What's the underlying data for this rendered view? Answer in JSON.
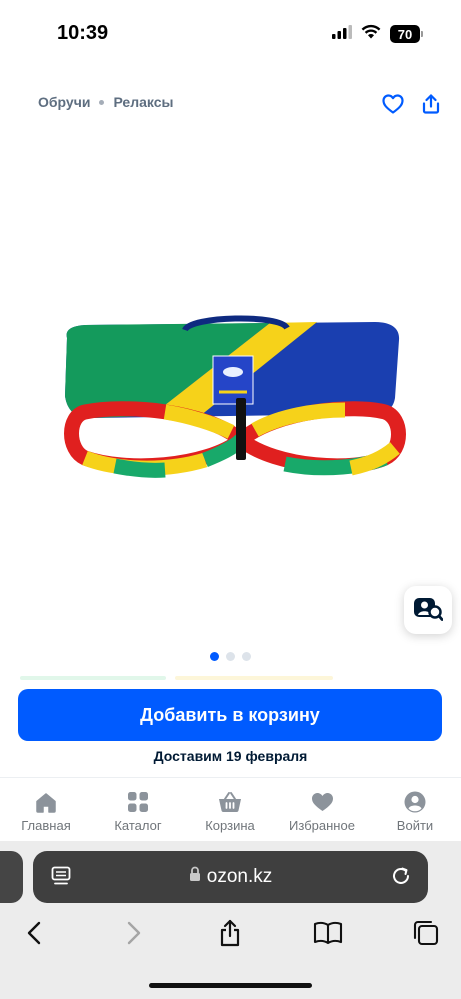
{
  "status": {
    "time": "10:39",
    "battery": "70"
  },
  "breadcrumb": {
    "items": [
      "Обручи",
      "Релаксы"
    ]
  },
  "carousel": {
    "count": 3,
    "active": 0
  },
  "cta": {
    "add_to_cart": "Добавить в корзину",
    "delivery": "Доставим 19 февраля"
  },
  "tabbar": {
    "items": [
      {
        "label": "Главная",
        "icon": "home-icon"
      },
      {
        "label": "Каталог",
        "icon": "catalog-icon"
      },
      {
        "label": "Корзина",
        "icon": "cart-icon"
      },
      {
        "label": "Избранное",
        "icon": "heart-icon"
      },
      {
        "label": "Войти",
        "icon": "profile-icon"
      }
    ]
  },
  "browser": {
    "url": "ozon.kz"
  },
  "colors": {
    "accent": "#005bff",
    "text": "#001a34",
    "muted": "#70757a"
  }
}
